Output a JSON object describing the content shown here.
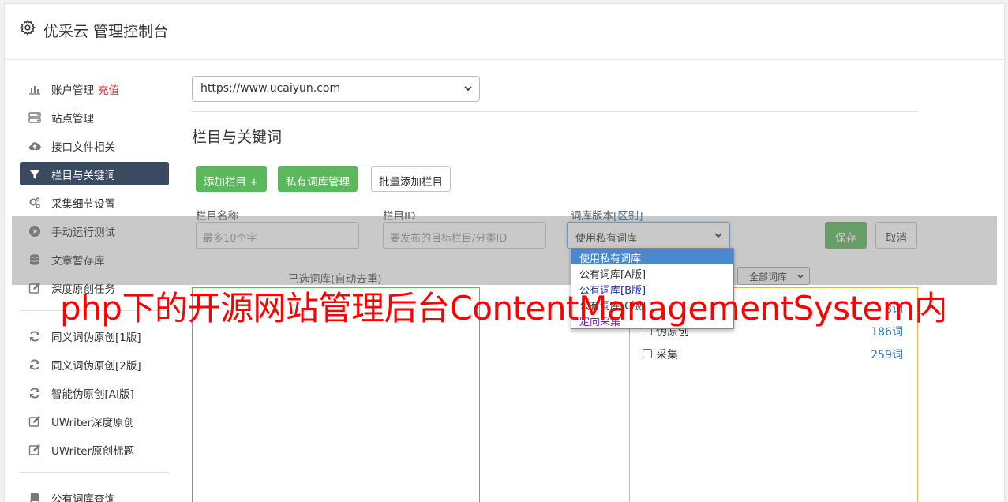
{
  "header": {
    "gear_icon": "gear-icon",
    "title": "优采云 管理控制台"
  },
  "sidebar": {
    "groups": [
      [
        {
          "icon": "bar-chart-icon",
          "label": "账户管理",
          "extra": "充值",
          "active": false
        },
        {
          "icon": "server-icon",
          "label": "站点管理",
          "active": false
        },
        {
          "icon": "cloud-upload-icon",
          "label": "接口文件相关",
          "active": false
        },
        {
          "icon": "filter-icon",
          "label": "栏目与关键词",
          "active": true
        },
        {
          "icon": "cogs-icon",
          "label": "采集细节设置",
          "active": false
        },
        {
          "icon": "play-circle-icon",
          "label": "手动运行测试",
          "active": false
        },
        {
          "icon": "database-icon",
          "label": "文章暂存库",
          "active": false
        },
        {
          "icon": "edit-icon",
          "label": "深度原创任务",
          "active": false
        }
      ],
      [
        {
          "icon": "refresh-icon",
          "label": "同义词伪原创[1版]",
          "active": false
        },
        {
          "icon": "refresh-icon",
          "label": "同义词伪原创[2版]",
          "active": false
        },
        {
          "icon": "refresh-icon",
          "label": "智能伪原创[AI版]",
          "active": false
        },
        {
          "icon": "edit-icon",
          "label": "UWriter深度原创",
          "active": false
        },
        {
          "icon": "edit-icon",
          "label": "UWriter原创标题",
          "active": false
        }
      ],
      [
        {
          "icon": "book-icon",
          "label": "公有词库查询",
          "active": false
        }
      ]
    ]
  },
  "main": {
    "site_select_value": "https://www.ucaiyun.com",
    "section_title": "栏目与关键词",
    "buttons": {
      "add_column": "添加栏目 +",
      "private_lib": "私有词库管理",
      "batch_add": "批量添加栏目"
    },
    "form": {
      "name_label": "栏目名称",
      "name_placeholder": "最多10个字",
      "id_label": "栏目ID",
      "id_placeholder": "要发布的目标栏目/分类ID",
      "lib_label": "词库版本",
      "lib_diff_link": "[区别]",
      "lib_value": "使用私有词库",
      "save": "保存",
      "cancel": "取消"
    },
    "selected_title": "已选词库(自动去重)",
    "filter_value": "全部词库",
    "libraries": [
      {
        "name": "",
        "count": "8词"
      },
      {
        "name": "伪原创",
        "count": "186词"
      },
      {
        "name": "采集",
        "count": "259词"
      }
    ],
    "dropdown_options": [
      {
        "label": "使用私有词库",
        "style": "sel"
      },
      {
        "label": "公有词库[A版]",
        "style": "c-dark"
      },
      {
        "label": "公有词库[B版]",
        "style": "c-blue"
      },
      {
        "label": "公有词库[C版]",
        "style": "c-dark"
      },
      {
        "label": "定向采集",
        "style": "c-purple"
      }
    ]
  },
  "watermark": "php下的开源网站管理后台ContentManagementSystem内"
}
